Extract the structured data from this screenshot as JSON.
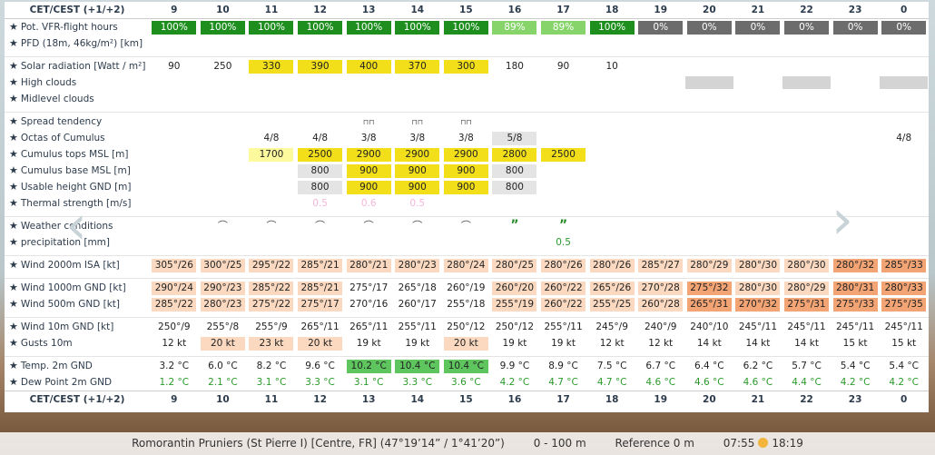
{
  "header_label": "CET/CEST (+1/+2)",
  "hours": [
    "9",
    "10",
    "11",
    "12",
    "13",
    "14",
    "15",
    "16",
    "17",
    "18",
    "19",
    "20",
    "21",
    "22",
    "23",
    "0"
  ],
  "rows": {
    "vfr": {
      "label": "Pot. VFR-flight hours",
      "values": [
        "100%",
        "100%",
        "100%",
        "100%",
        "100%",
        "100%",
        "100%",
        "89%",
        "89%",
        "100%",
        "0%",
        "0%",
        "0%",
        "0%",
        "0%",
        "0%"
      ]
    },
    "pfd": {
      "label": "PFD (18m, 46kg/m²) [km]"
    },
    "solar": {
      "label": "Solar radiation [Watt / m²]",
      "values": [
        "90",
        "250",
        "330",
        "390",
        "400",
        "370",
        "300",
        "180",
        "90",
        "10",
        "",
        "",
        "",
        "",
        "",
        ""
      ]
    },
    "high": {
      "label": "High clouds"
    },
    "mid": {
      "label": "Midlevel clouds"
    },
    "spread": {
      "label": "Spread tendency",
      "values": [
        "",
        "",
        "",
        "",
        "⊓⊓",
        "⊓⊓",
        "⊓⊓",
        "",
        "",
        "",
        "",
        "",
        "",
        "",
        "",
        ""
      ]
    },
    "octas": {
      "label": "Octas of Cumulus",
      "values": [
        "",
        "",
        "4/8",
        "4/8",
        "3/8",
        "3/8",
        "3/8",
        "5/8",
        "",
        "",
        "",
        "",
        "",
        "",
        "",
        "4/8"
      ]
    },
    "cutops": {
      "label": "Cumulus tops MSL [m]",
      "values": [
        "",
        "",
        "1700",
        "2500",
        "2900",
        "2900",
        "2900",
        "2800",
        "2500",
        "",
        "",
        "",
        "",
        "",
        "",
        ""
      ]
    },
    "cubase": {
      "label": "Cumulus base MSL [m]",
      "values": [
        "",
        "",
        "",
        "800",
        "900",
        "900",
        "900",
        "800",
        "",
        "",
        "",
        "",
        "",
        "",
        "",
        ""
      ]
    },
    "usable": {
      "label": "Usable height GND [m]",
      "values": [
        "",
        "",
        "",
        "800",
        "900",
        "900",
        "900",
        "800",
        "",
        "",
        "",
        "",
        "",
        "",
        "",
        ""
      ]
    },
    "thermal": {
      "label": "Thermal strength [m/s]",
      "values": [
        "",
        "",
        "",
        "0.5",
        "0.6",
        "0.5",
        "",
        "",
        "",
        "",
        "",
        "",
        "",
        "",
        "",
        ""
      ]
    },
    "weather": {
      "label": "Weather conditions",
      "values": [
        "",
        "⌒",
        "⌒",
        "⌒",
        "⌒",
        "⌒",
        "⌒",
        "”",
        "”",
        "",
        "",
        "",
        "",
        "",
        "",
        ""
      ]
    },
    "precip": {
      "label": "precipitation [mm]",
      "values": [
        "",
        "",
        "",
        "",
        "",
        "",
        "",
        "",
        "0.5",
        "",
        "",
        "",
        "",
        "",
        "",
        ""
      ]
    },
    "w2000": {
      "label": "Wind 2000m ISA [kt]",
      "values": [
        "305°/26",
        "300°/25",
        "295°/22",
        "285°/21",
        "280°/21",
        "280°/23",
        "280°/24",
        "280°/25",
        "280°/26",
        "280°/26",
        "285°/27",
        "280°/29",
        "280°/30",
        "280°/30",
        "280°/32",
        "285°/33"
      ]
    },
    "w1000": {
      "label": "Wind 1000m GND [kt]",
      "values": [
        "290°/24",
        "290°/23",
        "285°/22",
        "285°/21",
        "275°/17",
        "265°/18",
        "260°/19",
        "260°/20",
        "260°/22",
        "265°/26",
        "270°/28",
        "275°/32",
        "280°/30",
        "280°/29",
        "280°/31",
        "280°/33"
      ]
    },
    "w500": {
      "label": "Wind 500m GND [kt]",
      "values": [
        "285°/22",
        "280°/23",
        "275°/22",
        "275°/17",
        "270°/16",
        "260°/17",
        "255°/18",
        "255°/19",
        "260°/22",
        "255°/25",
        "260°/28",
        "265°/31",
        "270°/32",
        "275°/31",
        "275°/33",
        "275°/35"
      ]
    },
    "w10": {
      "label": "Wind 10m GND [kt]",
      "values": [
        "250°/9",
        "255°/8",
        "255°/9",
        "265°/11",
        "265°/11",
        "255°/11",
        "250°/12",
        "250°/12",
        "255°/11",
        "245°/9",
        "240°/9",
        "240°/10",
        "245°/11",
        "245°/11",
        "245°/11",
        "245°/11"
      ]
    },
    "gusts": {
      "label": "Gusts 10m",
      "values": [
        "12 kt",
        "20 kt",
        "23 kt",
        "20 kt",
        "19 kt",
        "19 kt",
        "20 kt",
        "19 kt",
        "19 kt",
        "12 kt",
        "12 kt",
        "14 kt",
        "14 kt",
        "14 kt",
        "15 kt",
        "15 kt"
      ]
    },
    "temp": {
      "label": "Temp. 2m GND",
      "values": [
        "3.2 °C",
        "6.0 °C",
        "8.2 °C",
        "9.6 °C",
        "10.2 °C",
        "10.4 °C",
        "10.4 °C",
        "9.9 °C",
        "8.9 °C",
        "7.5 °C",
        "6.7 °C",
        "6.4 °C",
        "6.2 °C",
        "5.7 °C",
        "5.4 °C",
        "5.4 °C"
      ]
    },
    "dew": {
      "label": "Dew Point 2m GND",
      "values": [
        "1.2 °C",
        "2.1 °C",
        "3.1 °C",
        "3.3 °C",
        "3.1 °C",
        "3.3 °C",
        "3.6 °C",
        "4.2 °C",
        "4.7 °C",
        "4.7 °C",
        "4.6 °C",
        "4.6 °C",
        "4.6 °C",
        "4.4 °C",
        "4.2 °C",
        "4.2 °C"
      ]
    }
  },
  "footer": {
    "location": "Romorantin Pruniers (St Pierre I) [Centre, FR] (47°19’14” / 1°41’20”)",
    "range": "0 - 100 m",
    "reference": "Reference 0 m",
    "sunrise": "07:55",
    "sunset": "18:19"
  },
  "colors": {
    "vfr_full": "#1e8f1e",
    "vfr_partial": "#86d46a",
    "vfr_none": "#6c6c6c",
    "solar_high": "#f2df1a",
    "wind_light": "#fad9c0",
    "wind_strong": "#f3a474",
    "temp_high": "#5fc65f",
    "dew": "#2a9a2a"
  },
  "icons": {
    "prev": "chevron-left-icon",
    "next": "chevron-right-icon",
    "star": "star-icon",
    "sun": "sun-icon"
  }
}
